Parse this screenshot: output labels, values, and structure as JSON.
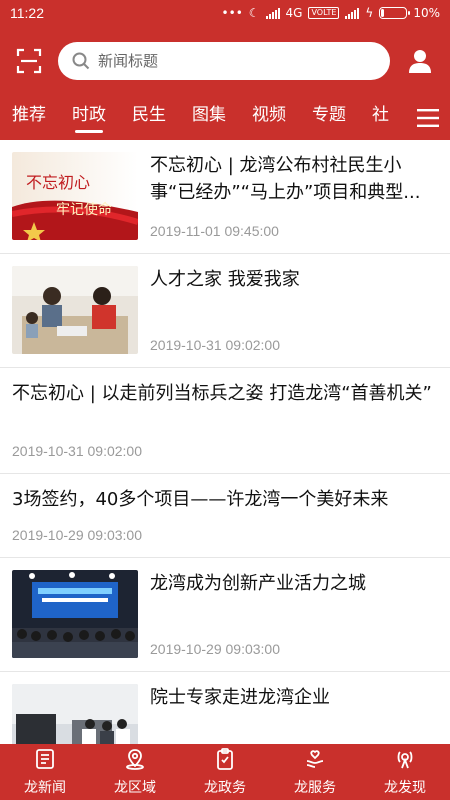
{
  "statusbar": {
    "time": "11:22",
    "network": "4G",
    "volte": "VOLTE",
    "battery": "10%",
    "battery_level": 0.1
  },
  "search": {
    "placeholder": "新闻标题"
  },
  "tabs": [
    {
      "label": "推荐",
      "active": false
    },
    {
      "label": "时政",
      "active": true
    },
    {
      "label": "民生",
      "active": false
    },
    {
      "label": "图集",
      "active": false
    },
    {
      "label": "视频",
      "active": false
    },
    {
      "label": "专题",
      "active": false
    },
    {
      "label": "社",
      "active": false
    }
  ],
  "news": [
    {
      "title": "不忘初心 | 龙湾公布村社民生小事“已经办”“马上办”项目和典型...",
      "date": "2019-11-01 09:45:00",
      "thumb": "slogan",
      "thumb_text": "不忘初心 牢记使命"
    },
    {
      "title": "人才之家 我爱我家",
      "date": "2019-10-31 09:02:00",
      "thumb": "people"
    },
    {
      "title": "不忘初心 | 以走前列当标兵之姿 打造龙湾“首善机关”",
      "date": "2019-10-31 09:02:00",
      "thumb": ""
    },
    {
      "title": "3场签约，40多个项目——许龙湾一个美好未来",
      "date": "2019-10-29 09:03:00",
      "thumb": ""
    },
    {
      "title": "龙湾成为创新产业活力之城",
      "date": "2019-10-29 09:03:00",
      "thumb": "stage"
    },
    {
      "title": "院士专家走进龙湾企业",
      "date": "",
      "thumb": "factory"
    }
  ],
  "bottom_nav": [
    {
      "label": "龙新闻",
      "icon": "news-icon"
    },
    {
      "label": "龙区域",
      "icon": "location-icon"
    },
    {
      "label": "龙政务",
      "icon": "clipboard-icon"
    },
    {
      "label": "龙服务",
      "icon": "service-icon"
    },
    {
      "label": "龙发现",
      "icon": "discover-icon"
    }
  ],
  "colors": {
    "brand": "#c9302c",
    "date": "#9a9a9a"
  }
}
